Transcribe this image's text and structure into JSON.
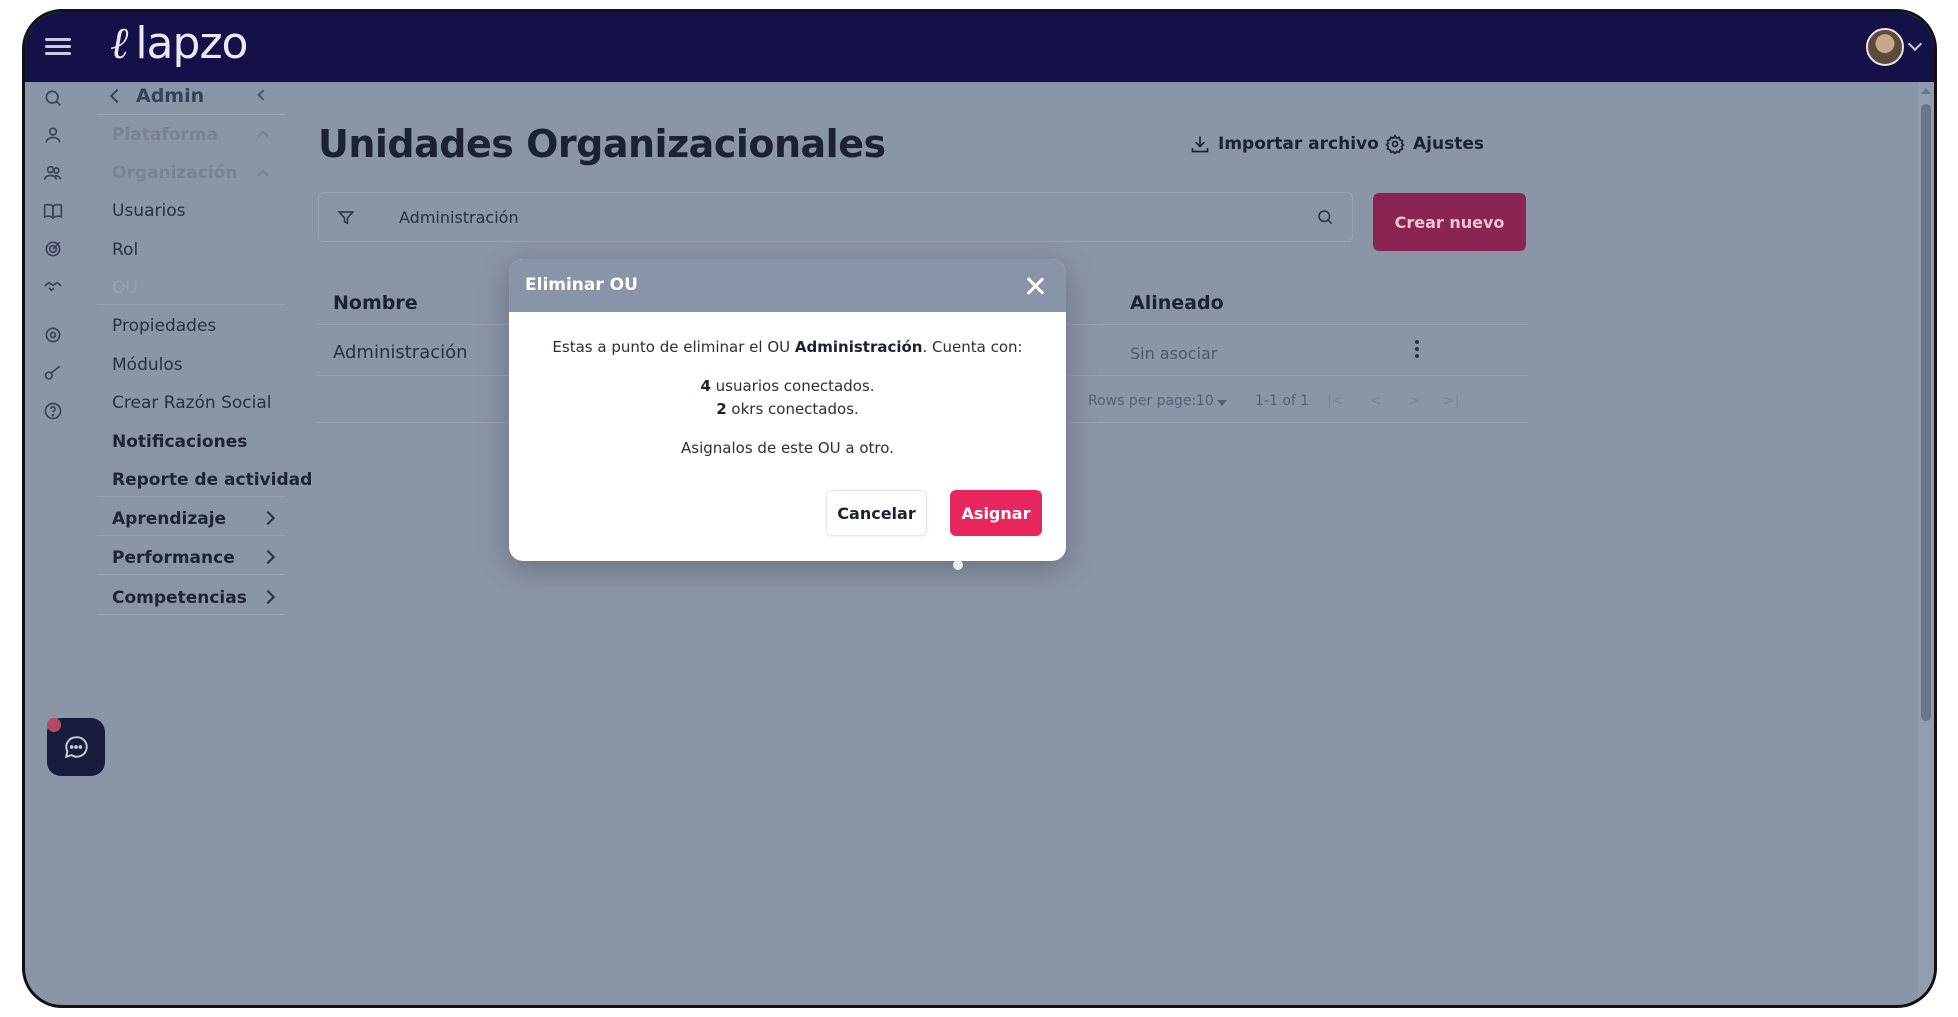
{
  "app": {
    "logo_text": "lapzo",
    "logo_mark": "ℓ"
  },
  "header": {
    "menu_icon": "hamburger-icon",
    "avatar_icon": "user-avatar"
  },
  "sidebar": {
    "back_label": "Admin",
    "items": [
      {
        "label": "Plataforma",
        "style": "muted",
        "expanded": true
      },
      {
        "label": "Organización",
        "style": "muted",
        "expanded": true
      },
      {
        "label": "Usuarios",
        "style": "normal"
      },
      {
        "label": "Rol",
        "style": "normal"
      },
      {
        "label": "OU",
        "style": "faded"
      },
      {
        "label": "Propiedades",
        "style": "normal"
      },
      {
        "label": "Módulos",
        "style": "normal"
      },
      {
        "label": "Crear Razón Social",
        "style": "normal"
      },
      {
        "label": "Notificaciones",
        "style": "bold"
      },
      {
        "label": "Reporte de actividad",
        "style": "bold"
      },
      {
        "label": "Aprendizaje",
        "style": "bold",
        "has_submenu": true
      },
      {
        "label": "Performance",
        "style": "bold",
        "has_submenu": true
      },
      {
        "label": "Competencias",
        "style": "bold",
        "has_submenu": true
      }
    ]
  },
  "page": {
    "title": "Unidades Organizacionales",
    "import_label": "Importar archivo",
    "settings_label": "Ajustes",
    "search_value": "Administración",
    "create_label": "Crear nuevo"
  },
  "table": {
    "headers": {
      "name": "Nombre",
      "aligned": "Alineado"
    },
    "rows": [
      {
        "name": "Administración",
        "aligned": "Sin asociar"
      }
    ],
    "pagination": {
      "rows_per_page_label": "Rows per page:",
      "rows_per_page": "10",
      "range": "1-1 of 1"
    }
  },
  "modal": {
    "title": "Eliminar OU",
    "intro_prefix": "Estas a punto de eliminar el OU ",
    "ou_name": "Administración",
    "intro_suffix": ". Cuenta con:",
    "users_count": "4",
    "users_text": " usuarios conectados.",
    "okrs_count": "2",
    "okrs_text": " okrs conectados.",
    "instruction": "Asignalos de este OU a otro.",
    "cancel_label": "Cancelar",
    "confirm_label": "Asignar"
  },
  "colors": {
    "topbar": "#141149",
    "overlay": "#8b95a8",
    "primary": "#e8265e",
    "primary_dimmed": "#8a2452"
  }
}
